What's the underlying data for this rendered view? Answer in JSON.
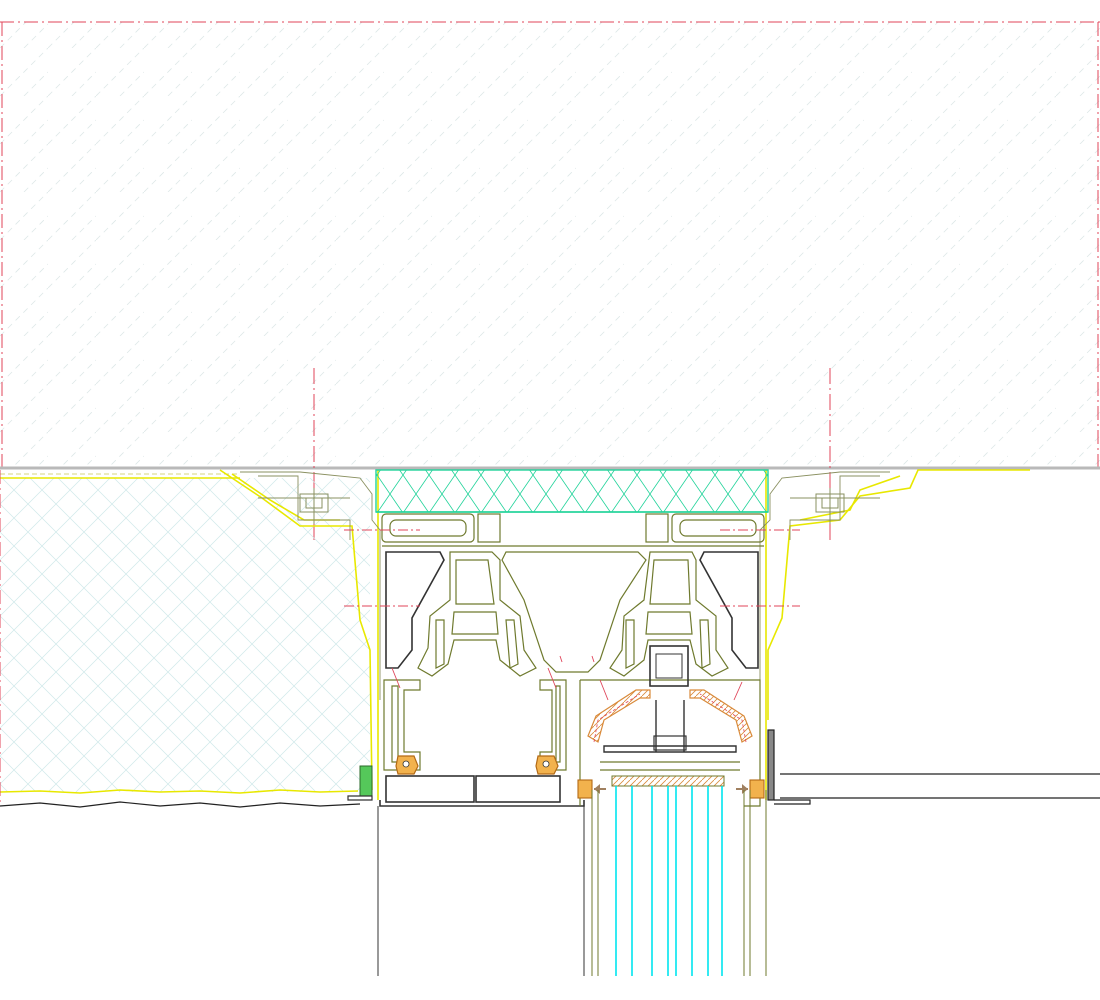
{
  "drawing": {
    "kind": "cad-section-detail",
    "text_labels": [],
    "colors": {
      "background": "#ffffff",
      "centerline": "#e0455a",
      "frame_profile": "#6f7a2e",
      "aluminium_dark": "#333333",
      "yellow_membrane": "#e8e800",
      "insulation": "#22d39a",
      "thermal_break": "#d98a3a",
      "glass": "#00e5ee",
      "hatch_wall": "#cfe9ea",
      "hatch_slab": "#dde7e7",
      "slab_edge": "#b9b9b9"
    },
    "layers": [
      "concrete-slab-hatch",
      "wall-panel-hatch",
      "insulation-block",
      "frame-profile",
      "thermal-break",
      "glass-unit",
      "centerlines"
    ]
  }
}
